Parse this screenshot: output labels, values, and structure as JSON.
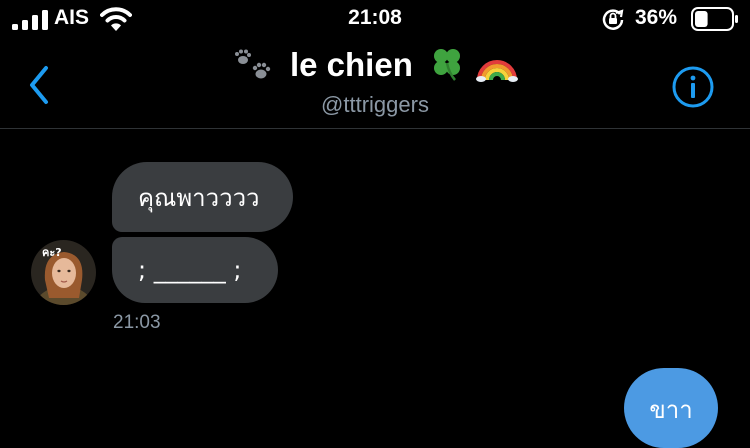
{
  "status_bar": {
    "carrier": "AIS",
    "time": "21:08",
    "battery_percent": "36%",
    "battery_level": 0.36
  },
  "header": {
    "title": "le chien",
    "handle": "@tttriggers",
    "title_icons": [
      "paw-prints-icon",
      "four-leaf-clover-icon",
      "rainbow-icon"
    ]
  },
  "conversation": {
    "incoming_messages": [
      {
        "text": "คุณพาวววว"
      },
      {
        "text": "; ______ ;"
      }
    ],
    "incoming_timestamp": "21:03",
    "avatar_caption": "คะ?",
    "outgoing_messages": [
      {
        "text": "ขาา"
      }
    ]
  },
  "colors": {
    "background": "#000000",
    "accent": "#1d9bf0",
    "incoming_bubble": "#3a3d40",
    "outgoing_bubble": "#4c9ae3",
    "muted_text": "#8b98a5"
  }
}
